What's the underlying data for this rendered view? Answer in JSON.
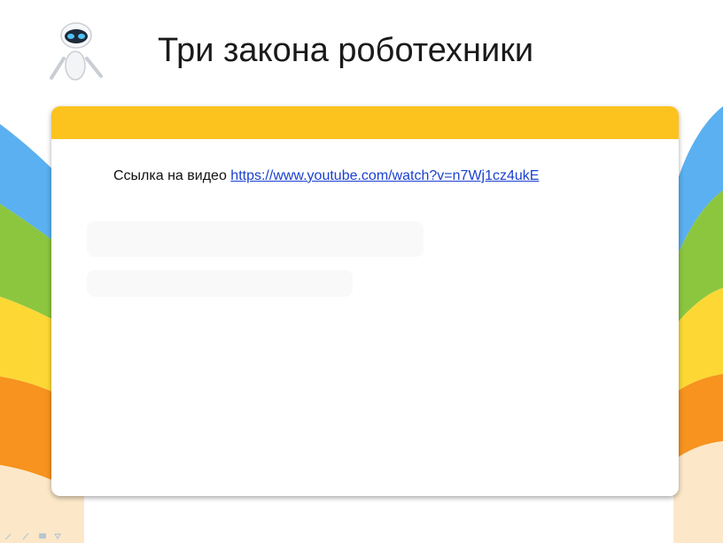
{
  "slide": {
    "title": "Три закона роботехники",
    "text_prefix": "Ссылка на видео",
    "link": "https://www.youtube.com/watch?v=n7Wj1cz4ukE"
  },
  "colors": {
    "band": "#fcc31e",
    "blue": "#5ab0f0",
    "green": "#8cc63f",
    "yellow": "#fdd835",
    "orange": "#f7931e",
    "link": "#1a3fd0"
  },
  "icons": [
    "robot-icon",
    "pen-icon",
    "pointer-icon",
    "menu-icon",
    "slide-icon"
  ]
}
